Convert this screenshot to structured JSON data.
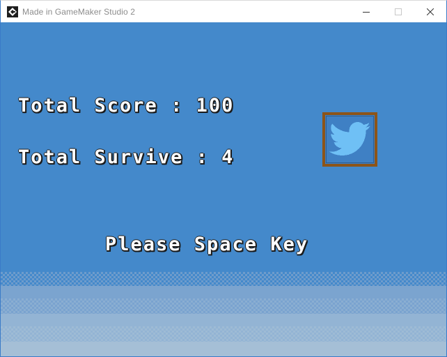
{
  "window": {
    "title": "Made in GameMaker Studio 2",
    "app_icon": "gamemaker-icon",
    "controls": [
      "minimize-icon",
      "maximize-icon",
      "close-icon"
    ]
  },
  "game": {
    "score_text": "Total Score : 100",
    "survive_text": "Total Survive : 4",
    "prompt_text": "Please Space Key",
    "share_button_icon": "twitter-bird-icon"
  },
  "colors": {
    "sky": "#4489cb",
    "text": "#ffffff",
    "text_outline": "#1b1b1b",
    "button_border": "#8c5419",
    "bird": "#6fc0f5"
  }
}
